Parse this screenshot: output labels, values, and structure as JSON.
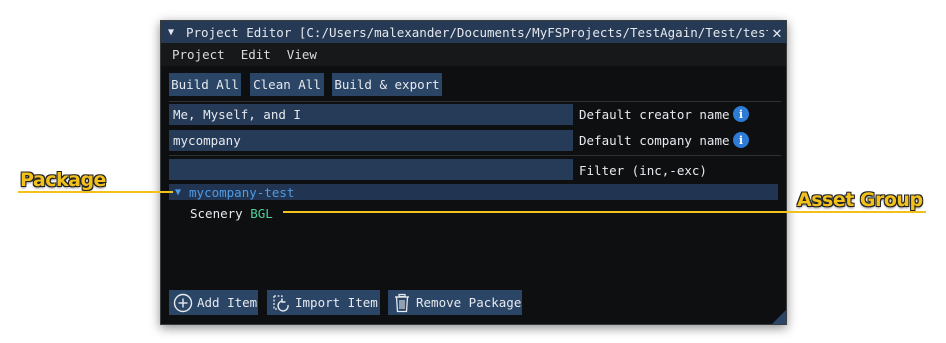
{
  "window": {
    "title": "Project Editor [C:/Users/malexander/Documents/MyFSProjects/TestAgain/Test/test/t",
    "collapse_glyph": "▼",
    "close_glyph": "✕"
  },
  "menu": {
    "items": [
      "Project",
      "Edit",
      "View"
    ]
  },
  "toolbar": {
    "build_all": "Build All",
    "clean_all": "Clean All",
    "build_export": "Build & export"
  },
  "fields": {
    "creator": {
      "value": "Me, Myself, and I",
      "label": "Default creator name",
      "info": "i"
    },
    "company": {
      "value": "mycompany",
      "label": "Default company name",
      "info": "i"
    },
    "filter": {
      "value": "",
      "label": "Filter (inc,-exc)"
    }
  },
  "tree": {
    "package": {
      "arrow": "▼",
      "name": "mycompany-test"
    },
    "asset_group": {
      "name": "Scenery",
      "type": "BGL"
    }
  },
  "footer": {
    "add_item": "Add Item",
    "import_item": "Import Item",
    "remove_package": "Remove Package"
  },
  "callouts": {
    "package": "Package",
    "asset_group": "Asset Group"
  },
  "colors": {
    "accent_blue": "#4e9be6",
    "asset_type_green": "#4cd19a",
    "callout_yellow": "#f2c11b",
    "button_blue": "#2b4566",
    "info_blue": "#2c7bd6"
  },
  "icons": {
    "add": "add-circle-icon",
    "import": "import-icon",
    "remove": "trash-icon",
    "info": "info-icon"
  }
}
